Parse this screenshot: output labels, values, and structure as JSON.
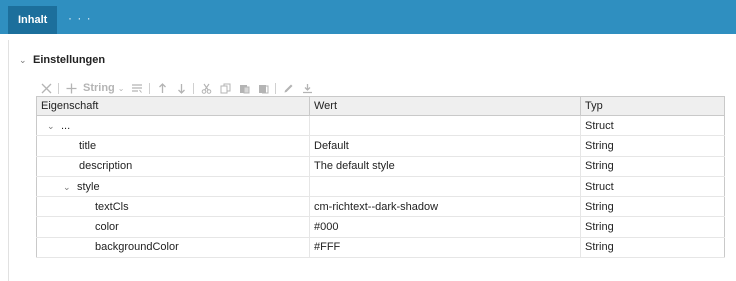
{
  "header": {
    "active_tab": "Inhalt",
    "more": "· · ·"
  },
  "section": {
    "chevron": "⌄",
    "title": "Einstellungen"
  },
  "toolbar": {
    "string_label": "String",
    "string_caret": "⌄"
  },
  "grid": {
    "columns": [
      "Eigenschaft",
      "Wert",
      "Typ"
    ],
    "rows": [
      {
        "caret": "⌄",
        "property": "...",
        "value": "",
        "type": "Struct"
      },
      {
        "property": "title",
        "value": "Default",
        "type": "String"
      },
      {
        "property": "description",
        "value": "The default style",
        "type": "String"
      },
      {
        "caret": "⌄",
        "property": "style",
        "value": "",
        "type": "Struct"
      },
      {
        "property": "textCls",
        "value": "cm-richtext--dark-shadow",
        "type": "String"
      },
      {
        "property": "color",
        "value": "#000",
        "type": "String"
      },
      {
        "property": "backgroundColor",
        "value": "#FFF",
        "type": "String"
      }
    ]
  },
  "colors": {
    "topbar": "#2f8fc0",
    "active_tab": "#1c6f9c",
    "toolbar_icon": "#b4b4b4",
    "grid_header": "#efefef"
  }
}
